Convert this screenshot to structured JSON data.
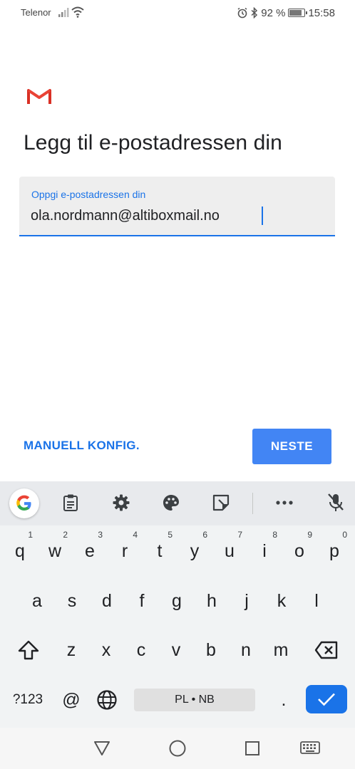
{
  "status": {
    "carrier": "Telenor",
    "battery_percent": "92 %",
    "battery_level": 0.92,
    "time": "15:58"
  },
  "page": {
    "title": "Legg til e-postadressen din",
    "email_label": "Oppgi e-postadressen din",
    "email_value": "ola.nordmann@altiboxmail.no",
    "manual_button": "MANUELL KONFIG.",
    "next_button": "NESTE"
  },
  "colors": {
    "accent": "#1a73e8",
    "button": "#4285f4"
  },
  "keyboard": {
    "toolbar": [
      "google-g-icon",
      "clipboard-icon",
      "gear-icon",
      "palette-icon",
      "sticker-icon",
      "more-icon",
      "mic-off-icon"
    ],
    "row1": [
      {
        "k": "q",
        "h": "1"
      },
      {
        "k": "w",
        "h": "2"
      },
      {
        "k": "e",
        "h": "3"
      },
      {
        "k": "r",
        "h": "4"
      },
      {
        "k": "t",
        "h": "5"
      },
      {
        "k": "y",
        "h": "6"
      },
      {
        "k": "u",
        "h": "7"
      },
      {
        "k": "i",
        "h": "8"
      },
      {
        "k": "o",
        "h": "9"
      },
      {
        "k": "p",
        "h": "0"
      }
    ],
    "row2": [
      "a",
      "s",
      "d",
      "f",
      "g",
      "h",
      "j",
      "k",
      "l"
    ],
    "row3": [
      "z",
      "x",
      "c",
      "v",
      "b",
      "n",
      "m"
    ],
    "symbols_key": "?123",
    "at_key": "@",
    "space_label": "PL • NB",
    "period_key": "."
  }
}
